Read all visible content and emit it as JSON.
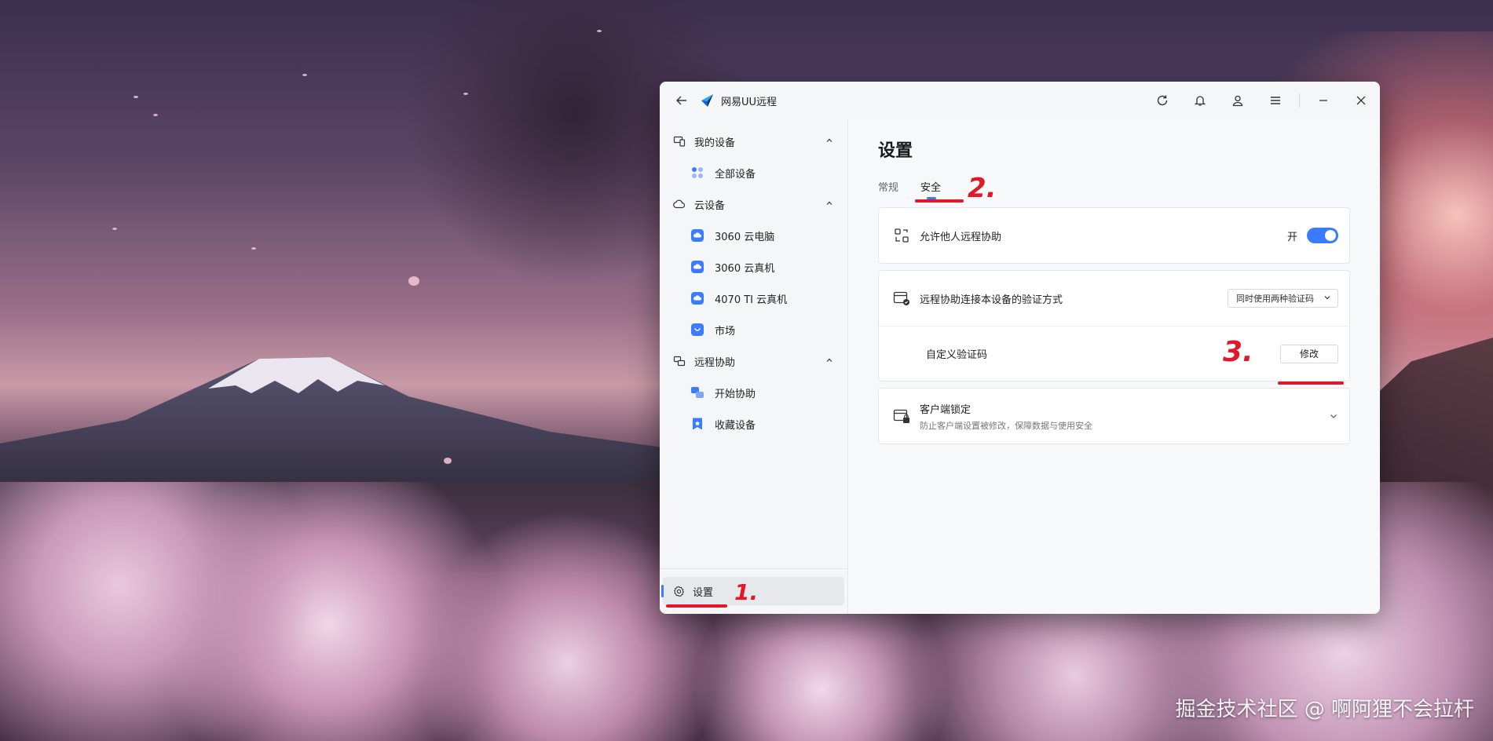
{
  "window": {
    "title": "网易UU远程"
  },
  "sidebar": {
    "groups": [
      {
        "label": "我的设备",
        "items": [
          {
            "label": "全部设备"
          }
        ]
      },
      {
        "label": "云设备",
        "items": [
          {
            "label": "3060 云电脑"
          },
          {
            "label": "3060 云真机"
          },
          {
            "label": "4070 TI 云真机"
          },
          {
            "label": "市场"
          }
        ]
      },
      {
        "label": "远程协助",
        "items": [
          {
            "label": "开始协助"
          },
          {
            "label": "收藏设备"
          }
        ]
      }
    ],
    "settings_label": "设置"
  },
  "main": {
    "title": "设置",
    "tabs": [
      {
        "label": "常规"
      },
      {
        "label": "安全"
      }
    ],
    "allow_remote": {
      "label": "允许他人远程协助",
      "state_label": "开",
      "enabled": true
    },
    "verify_method": {
      "label": "远程协助连接本设备的验证方式",
      "selected": "同时使用两种验证码"
    },
    "custom_code": {
      "label": "自定义验证码",
      "button_label": "修改"
    },
    "client_lock": {
      "label": "客户端锁定",
      "description": "防止客户端设置被修改，保障数据与使用安全"
    }
  },
  "annotations": {
    "one": "1.",
    "two": "2.",
    "three": "3."
  },
  "watermark": "掘金技术社区 @ 啊阿狸不会拉杆",
  "colors": {
    "accent": "#3a7bff",
    "annotation": "#e0182a"
  },
  "icons": {
    "titlebar": [
      "back-arrow-icon",
      "refresh-icon",
      "bell-icon",
      "user-icon",
      "menu-icon",
      "minimize-icon",
      "close-icon"
    ]
  }
}
